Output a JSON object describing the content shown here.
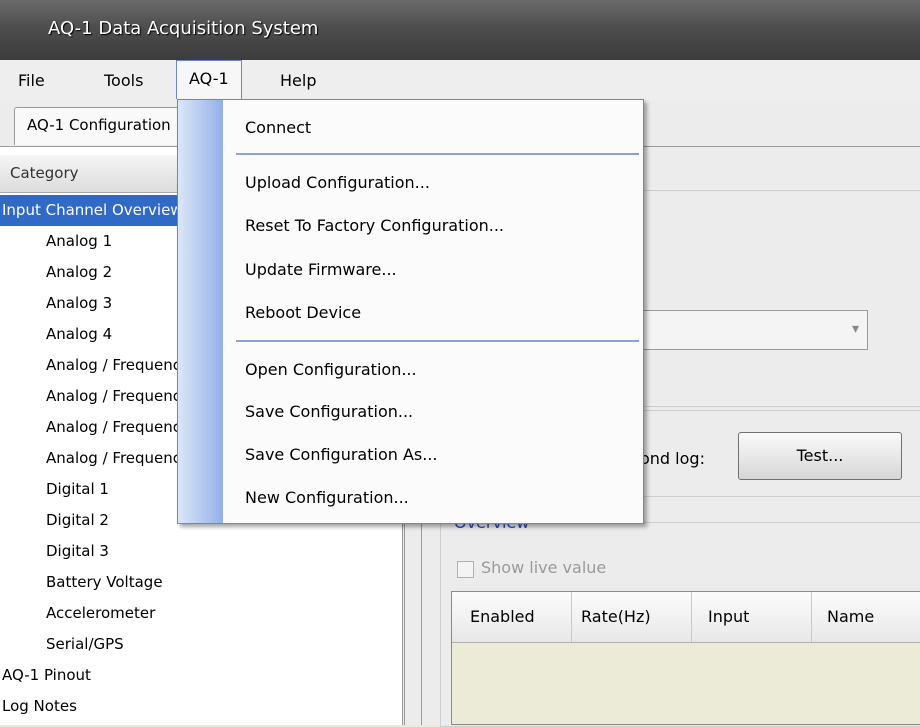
{
  "window": {
    "title": "AQ-1 Data Acquisition System"
  },
  "menubar": {
    "items": [
      "File",
      "Tools",
      "AQ-1",
      "Help"
    ]
  },
  "tabs": [
    {
      "label": "AQ-1 Configuration"
    }
  ],
  "category": {
    "header": "Category",
    "tree": [
      {
        "label": "Input Channel Overview",
        "level": 0,
        "selected": true
      },
      {
        "label": "Analog 1",
        "level": 1
      },
      {
        "label": "Analog 2",
        "level": 1
      },
      {
        "label": "Analog 3",
        "level": 1
      },
      {
        "label": "Analog 4",
        "level": 1
      },
      {
        "label": "Analog / Frequency",
        "level": 1
      },
      {
        "label": "Analog / Frequency",
        "level": 1
      },
      {
        "label": "Analog / Frequency",
        "level": 1
      },
      {
        "label": "Analog / Frequency",
        "level": 1
      },
      {
        "label": "Digital 1",
        "level": 1
      },
      {
        "label": "Digital 2",
        "level": 1
      },
      {
        "label": "Digital 3",
        "level": 1
      },
      {
        "label": "Battery Voltage",
        "level": 1
      },
      {
        "label": "Accelerometer",
        "level": 1
      },
      {
        "label": "Serial/GPS",
        "level": 1
      },
      {
        "label": "AQ-1 Pinout",
        "level": 0
      },
      {
        "label": "Log Notes",
        "level": 0
      }
    ]
  },
  "main": {
    "log_label": "ond log:",
    "test_button": "Test...",
    "overview_title": "Overview",
    "show_live_label": "Show live value",
    "show_live_checked": false,
    "grid_columns": [
      "Enabled",
      "Rate(Hz)",
      "Input",
      "Name"
    ]
  },
  "dropdown": {
    "groups": [
      [
        "Connect"
      ],
      [
        "Upload Configuration...",
        "Reset To Factory Configuration...",
        "Update Firmware...",
        "Reboot Device"
      ],
      [
        "Open Configuration...",
        "Save Configuration...",
        "Save Configuration As...",
        "New Configuration..."
      ]
    ]
  },
  "colors": {
    "selection": "#3169c6",
    "menu_border": "#6f85c7",
    "overview_text": "#2a4ac8"
  }
}
